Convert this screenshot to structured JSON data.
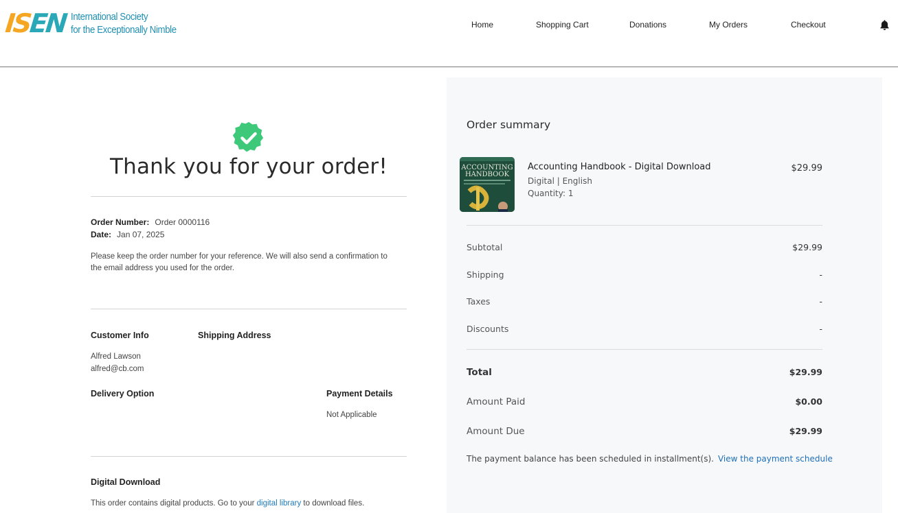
{
  "logo": {
    "mark_part1": "IS",
    "mark_part2": "EN",
    "line1": "International Society",
    "line2": "for the Exceptionally Nimble"
  },
  "nav": {
    "items": [
      "Home",
      "Shopping Cart",
      "Donations",
      "My Orders",
      "Checkout"
    ],
    "bell_icon": "bell-icon"
  },
  "confirmation": {
    "heading": "Thank you for your order!",
    "order_number_label": "Order Number:",
    "order_number": "Order 0000116",
    "date_label": "Date:",
    "date": "Jan 07, 2025",
    "note": "Please keep the order number for your reference. We will also send a confirmation to the email address you used for the order.",
    "customer_info_title": "Customer Info",
    "customer_name": "Alfred Lawson",
    "customer_email": "alfred@cb.com",
    "shipping_address_title": "Shipping Address",
    "delivery_option_title": "Delivery Option",
    "payment_details_title": "Payment Details",
    "payment_details_value": "Not Applicable",
    "digital_download_title": "Digital Download",
    "digital_text_before": "This order contains digital products. Go to your",
    "digital_link": "digital library",
    "digital_text_after": "to download files."
  },
  "summary": {
    "title": "Order summary",
    "product": {
      "name": "Accounting Handbook - Digital Download",
      "format": "Digital | English",
      "quantity": "Quantity: 1",
      "price": "$29.99",
      "cover_title_line1": "ACCOUNTING",
      "cover_title_line2": "HANDBOOK"
    },
    "rows": [
      {
        "label": "Subtotal",
        "value": "$29.99"
      },
      {
        "label": "Shipping",
        "value": "-"
      },
      {
        "label": "Taxes",
        "value": "-"
      },
      {
        "label": "Discounts",
        "value": "-"
      }
    ],
    "total_label": "Total",
    "total_value": "$29.99",
    "paid_label": "Amount Paid",
    "paid_value": "$0.00",
    "due_label": "Amount Due",
    "due_value": "$29.99",
    "schedule_text": "The payment balance has been scheduled in installment(s).",
    "schedule_link": "View the payment schedule"
  },
  "colors": {
    "accent_green": "#3ec97a",
    "link_blue": "#1f6fb8",
    "panel_bg": "#f7f8fa",
    "logo_orange": "#f5a623",
    "logo_teal": "#2aa8b8"
  }
}
